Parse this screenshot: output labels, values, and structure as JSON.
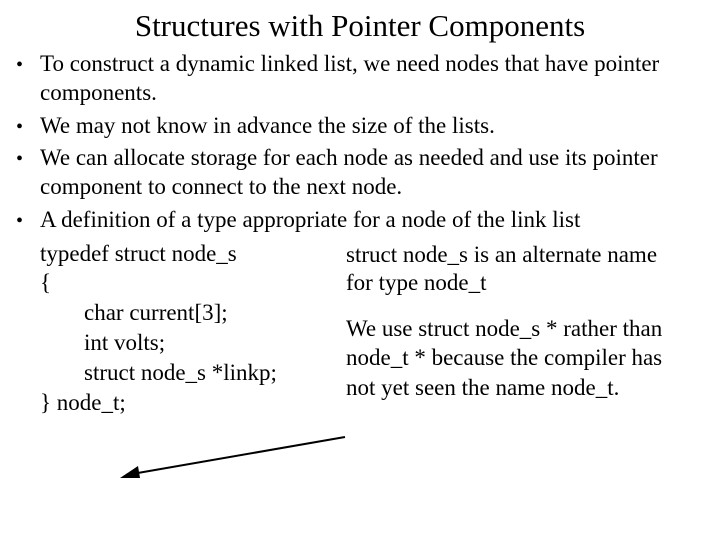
{
  "title": "Structures with Pointer Components",
  "bullets": {
    "b1": "To construct a dynamic linked list, we need nodes that have pointer components.",
    "b2": "We may not know in advance the size of the lists.",
    "b3": "We can allocate storage for each node as needed and use its pointer component to connect to the next node.",
    "b4": "A definition of a type appropriate for a node of the link list"
  },
  "code": {
    "l1": "typedef struct node_s",
    "l2": "{",
    "l3": "char current[3];",
    "l4": "int   volts;",
    "l5": "struct node_s *linkp;",
    "l6": "} node_t;"
  },
  "notes": {
    "n1": "struct node_s is an alternate name for type node_t",
    "n2": "We use struct node_s * rather than node_t * because the compiler has not yet seen the name node_t."
  }
}
